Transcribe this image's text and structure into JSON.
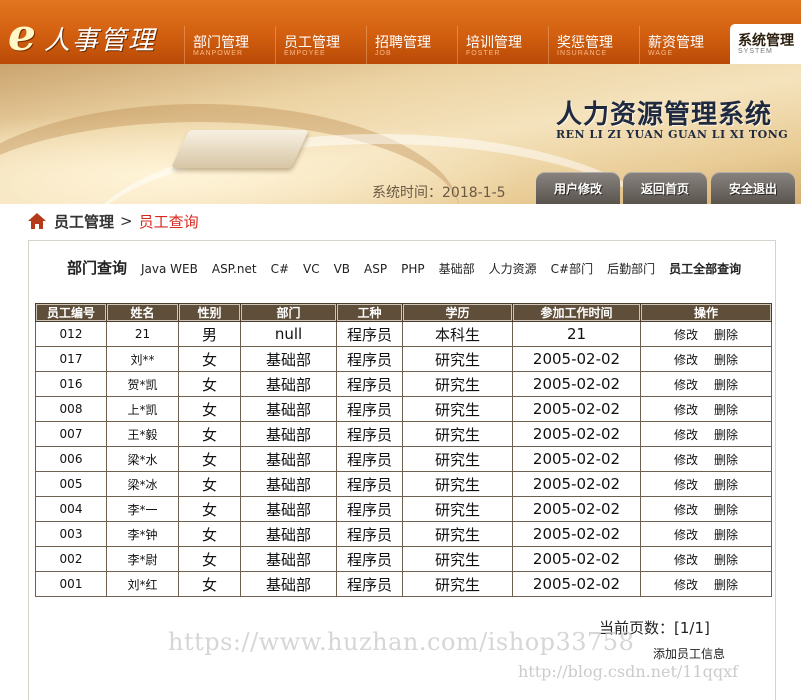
{
  "logo": {
    "e": "e",
    "text": "人事管理"
  },
  "nav": [
    {
      "zh": "部门管理",
      "en": "MANPOWER"
    },
    {
      "zh": "员工管理",
      "en": "EMPOYEE"
    },
    {
      "zh": "招聘管理",
      "en": "JOB"
    },
    {
      "zh": "培训管理",
      "en": "FOSTER"
    },
    {
      "zh": "奖惩管理",
      "en": "INSURANCE"
    },
    {
      "zh": "薪资管理",
      "en": "WAGE"
    },
    {
      "zh": "系统管理",
      "en": "SYSTEM"
    }
  ],
  "banner": {
    "title_zh": "人力资源管理系统",
    "title_en": "REN LI ZI YUAN GUAN LI XI TONG",
    "systime": "系统时间：2018-1-5",
    "buttons": [
      "用户修改",
      "返回首页",
      "安全退出"
    ]
  },
  "breadcrumb": {
    "level1": "员工管理",
    "sep": ">",
    "level2": "员工查询"
  },
  "dept_query": {
    "label": "部门查询",
    "links": [
      "Java WEB",
      "ASP.net",
      "C#",
      "VC",
      "VB",
      "ASP",
      "PHP",
      "基础部",
      "人力资源",
      "C#部门",
      "后勤部门"
    ],
    "all_link": "员工全部查询"
  },
  "table": {
    "headers": [
      "员工编号",
      "姓名",
      "性别",
      "部门",
      "工种",
      "学历",
      "参加工作时间",
      "操作"
    ],
    "edit_label": "修改",
    "delete_label": "删除",
    "rows": [
      [
        "012",
        "21",
        "男",
        "null",
        "程序员",
        "本科生",
        "21"
      ],
      [
        "017",
        "刘**",
        "女",
        "基础部",
        "程序员",
        "研究生",
        "2005-02-02"
      ],
      [
        "016",
        "贺*凯",
        "女",
        "基础部",
        "程序员",
        "研究生",
        "2005-02-02"
      ],
      [
        "008",
        "上*凯",
        "女",
        "基础部",
        "程序员",
        "研究生",
        "2005-02-02"
      ],
      [
        "007",
        "王*毅",
        "女",
        "基础部",
        "程序员",
        "研究生",
        "2005-02-02"
      ],
      [
        "006",
        "梁*水",
        "女",
        "基础部",
        "程序员",
        "研究生",
        "2005-02-02"
      ],
      [
        "005",
        "梁*冰",
        "女",
        "基础部",
        "程序员",
        "研究生",
        "2005-02-02"
      ],
      [
        "004",
        "李*一",
        "女",
        "基础部",
        "程序员",
        "研究生",
        "2005-02-02"
      ],
      [
        "003",
        "李*钟",
        "女",
        "基础部",
        "程序员",
        "研究生",
        "2005-02-02"
      ],
      [
        "002",
        "李*尉",
        "女",
        "基础部",
        "程序员",
        "研究生",
        "2005-02-02"
      ],
      [
        "001",
        "刘*红",
        "女",
        "基础部",
        "程序员",
        "研究生",
        "2005-02-02"
      ]
    ]
  },
  "pagination": {
    "text": "当前页数：[1/1]"
  },
  "add_link": "添加员工信息",
  "watermark": "https://www.huzhan.com/ishop33758",
  "watermark2": "http://blog.csdn.net/11qqxf",
  "colors": {
    "nav_orange": "#d25f10",
    "header_brown": "#5e4e3a",
    "breadcrumb_red": "#d8281c"
  }
}
